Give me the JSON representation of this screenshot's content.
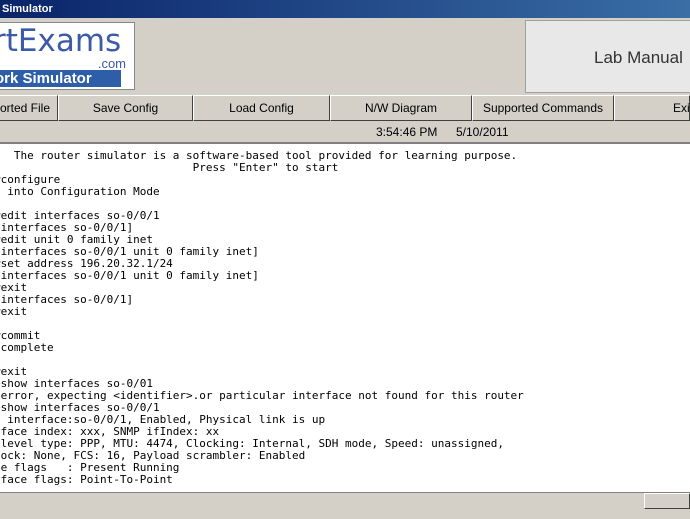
{
  "window": {
    "title": "Simulator"
  },
  "logo": {
    "brand": "rtExams",
    "dotcom": ".com",
    "sub": "ork Simulator"
  },
  "lab_panel": {
    "label": "Lab Manual"
  },
  "toolbar": {
    "buttons": [
      {
        "label": "orted File"
      },
      {
        "label": "Save Config"
      },
      {
        "label": "Load Config"
      },
      {
        "label": "N/W Diagram"
      },
      {
        "label": "Supported Commands"
      },
      {
        "label": "Exit"
      }
    ]
  },
  "status": {
    "time": "3:54:46 PM",
    "date": "5/10/2011"
  },
  "terminal": {
    "text": "   The router simulator is a software-based tool provided for learning purpose.\n                              Press \"Enter\" to start\n#configure\n  into Configuration Mode\n\n#edit interfaces so-0/0/1\n[interfaces so-0/0/1]\n#edit unit 0 family inet\n[interfaces so-0/0/1 unit 0 family inet]\n#set address 196.20.32.1/24\n[interfaces so-0/0/1 unit 0 family inet]\n#exit\n[interfaces so-0/0/1]\n#exit\n\n#commit\n complete\n\n#exit\n>show interfaces so-0/01\n error, expecting <identifier>.or particular interface not found for this router\n>show interfaces so-0/0/1\n  interface:so-0/0/1, Enabled, Physical link is up\n face index: xxx, SNMP ifIndex: xx\n level type: PPP, MTU: 4474, Clocking: Internal, SDH mode, Speed: unassigned,\n ock: None, FCS: 16, Payload scrambler: Enabled\n e flags   : Present Running\n face flags: Point-To-Point"
  }
}
